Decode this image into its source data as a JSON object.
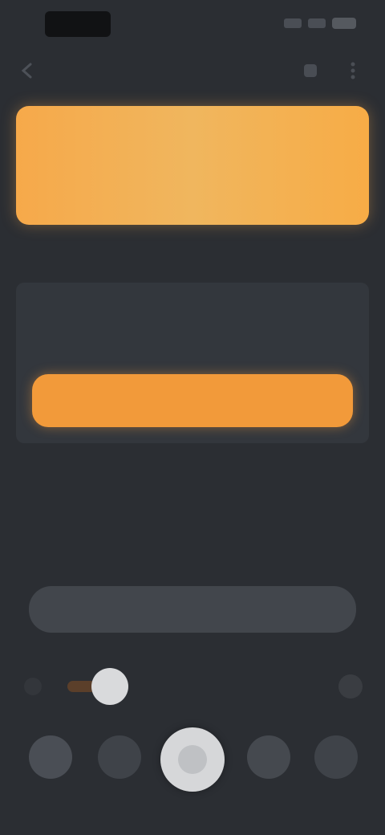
{
  "status_bar": {
    "time": "",
    "icons": [
      "signal-icon",
      "wifi-icon",
      "battery-icon"
    ]
  },
  "top_bar": {
    "title": "",
    "icons": [
      "back-icon",
      "more-icon",
      "overflow-icon"
    ]
  },
  "promo_card": {
    "line1": "",
    "line2": "",
    "color": "#f6a94a"
  },
  "section": {
    "label": ""
  },
  "info_panel": {
    "text": "",
    "button_label": "",
    "button_color": "#f29a3a"
  },
  "message_bar": {
    "placeholder": ""
  },
  "mode_row": {
    "active_label": ""
  },
  "bottom_controls": {
    "labels": [
      "",
      "",
      "",
      ""
    ],
    "icons": [
      "gallery-icon",
      "flash-icon",
      "shutter-icon",
      "camera-icon",
      "settings-icon"
    ]
  },
  "colors": {
    "background": "#2b2e33",
    "accent": "#f29a3a",
    "panel": "#33373d"
  }
}
